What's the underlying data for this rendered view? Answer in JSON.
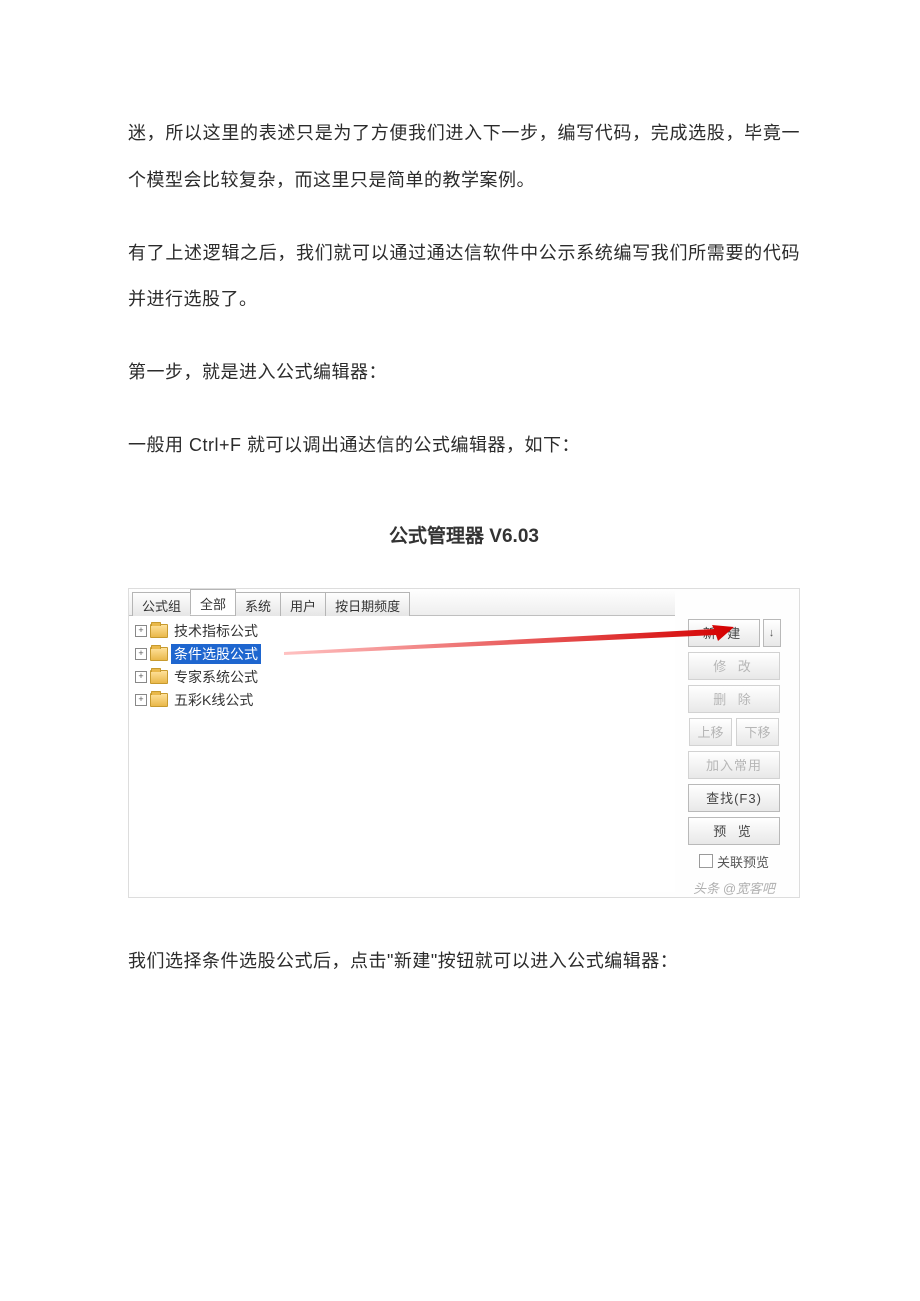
{
  "paragraphs": {
    "p1": "迷，所以这里的表述只是为了方便我们进入下一步，编写代码，完成选股，毕竟一个模型会比较复杂，而这里只是简单的教学案例。",
    "p2": "有了上述逻辑之后，我们就可以通过通达信软件中公示系统编写我们所需要的代码并进行选股了。",
    "p3": "第一步，就是进入公式编辑器：",
    "p4": "一般用 Ctrl+F 就可以调出通达信的公式编辑器，如下：",
    "p5": "我们选择条件选股公式后，点击\"新建\"按钮就可以进入公式编辑器："
  },
  "figureTitle": "公式管理器 V6.03",
  "tabs": {
    "group": "公式组",
    "all": "全部",
    "system": "系统",
    "user": "用户",
    "freq": "按日期频度"
  },
  "tree": {
    "item1": "技术指标公式",
    "item2": "条件选股公式",
    "item3": "专家系统公式",
    "item4": "五彩K线公式"
  },
  "buttons": {
    "new": "新 建",
    "modify": "修 改",
    "delete": "删 除",
    "up": "上移",
    "down": "下移",
    "addFav": "加入常用",
    "find": "查找(F3)",
    "preview": "预 览",
    "linkPrev": "关联预览"
  },
  "watermark": "头条 @宽客吧"
}
